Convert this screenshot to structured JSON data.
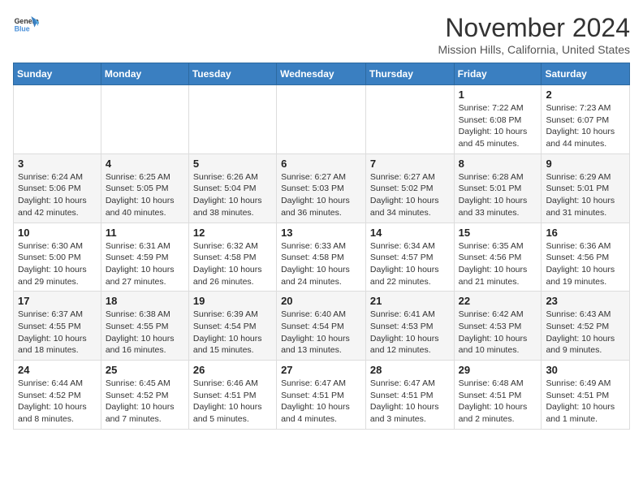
{
  "logo": {
    "line1": "General",
    "line2": "Blue"
  },
  "title": "November 2024",
  "location": "Mission Hills, California, United States",
  "days_of_week": [
    "Sunday",
    "Monday",
    "Tuesday",
    "Wednesday",
    "Thursday",
    "Friday",
    "Saturday"
  ],
  "weeks": [
    [
      {
        "day": "",
        "info": ""
      },
      {
        "day": "",
        "info": ""
      },
      {
        "day": "",
        "info": ""
      },
      {
        "day": "",
        "info": ""
      },
      {
        "day": "",
        "info": ""
      },
      {
        "day": "1",
        "info": "Sunrise: 7:22 AM\nSunset: 6:08 PM\nDaylight: 10 hours and 45 minutes."
      },
      {
        "day": "2",
        "info": "Sunrise: 7:23 AM\nSunset: 6:07 PM\nDaylight: 10 hours and 44 minutes."
      }
    ],
    [
      {
        "day": "3",
        "info": "Sunrise: 6:24 AM\nSunset: 5:06 PM\nDaylight: 10 hours and 42 minutes."
      },
      {
        "day": "4",
        "info": "Sunrise: 6:25 AM\nSunset: 5:05 PM\nDaylight: 10 hours and 40 minutes."
      },
      {
        "day": "5",
        "info": "Sunrise: 6:26 AM\nSunset: 5:04 PM\nDaylight: 10 hours and 38 minutes."
      },
      {
        "day": "6",
        "info": "Sunrise: 6:27 AM\nSunset: 5:03 PM\nDaylight: 10 hours and 36 minutes."
      },
      {
        "day": "7",
        "info": "Sunrise: 6:27 AM\nSunset: 5:02 PM\nDaylight: 10 hours and 34 minutes."
      },
      {
        "day": "8",
        "info": "Sunrise: 6:28 AM\nSunset: 5:01 PM\nDaylight: 10 hours and 33 minutes."
      },
      {
        "day": "9",
        "info": "Sunrise: 6:29 AM\nSunset: 5:01 PM\nDaylight: 10 hours and 31 minutes."
      }
    ],
    [
      {
        "day": "10",
        "info": "Sunrise: 6:30 AM\nSunset: 5:00 PM\nDaylight: 10 hours and 29 minutes."
      },
      {
        "day": "11",
        "info": "Sunrise: 6:31 AM\nSunset: 4:59 PM\nDaylight: 10 hours and 27 minutes."
      },
      {
        "day": "12",
        "info": "Sunrise: 6:32 AM\nSunset: 4:58 PM\nDaylight: 10 hours and 26 minutes."
      },
      {
        "day": "13",
        "info": "Sunrise: 6:33 AM\nSunset: 4:58 PM\nDaylight: 10 hours and 24 minutes."
      },
      {
        "day": "14",
        "info": "Sunrise: 6:34 AM\nSunset: 4:57 PM\nDaylight: 10 hours and 22 minutes."
      },
      {
        "day": "15",
        "info": "Sunrise: 6:35 AM\nSunset: 4:56 PM\nDaylight: 10 hours and 21 minutes."
      },
      {
        "day": "16",
        "info": "Sunrise: 6:36 AM\nSunset: 4:56 PM\nDaylight: 10 hours and 19 minutes."
      }
    ],
    [
      {
        "day": "17",
        "info": "Sunrise: 6:37 AM\nSunset: 4:55 PM\nDaylight: 10 hours and 18 minutes."
      },
      {
        "day": "18",
        "info": "Sunrise: 6:38 AM\nSunset: 4:55 PM\nDaylight: 10 hours and 16 minutes."
      },
      {
        "day": "19",
        "info": "Sunrise: 6:39 AM\nSunset: 4:54 PM\nDaylight: 10 hours and 15 minutes."
      },
      {
        "day": "20",
        "info": "Sunrise: 6:40 AM\nSunset: 4:54 PM\nDaylight: 10 hours and 13 minutes."
      },
      {
        "day": "21",
        "info": "Sunrise: 6:41 AM\nSunset: 4:53 PM\nDaylight: 10 hours and 12 minutes."
      },
      {
        "day": "22",
        "info": "Sunrise: 6:42 AM\nSunset: 4:53 PM\nDaylight: 10 hours and 10 minutes."
      },
      {
        "day": "23",
        "info": "Sunrise: 6:43 AM\nSunset: 4:52 PM\nDaylight: 10 hours and 9 minutes."
      }
    ],
    [
      {
        "day": "24",
        "info": "Sunrise: 6:44 AM\nSunset: 4:52 PM\nDaylight: 10 hours and 8 minutes."
      },
      {
        "day": "25",
        "info": "Sunrise: 6:45 AM\nSunset: 4:52 PM\nDaylight: 10 hours and 7 minutes."
      },
      {
        "day": "26",
        "info": "Sunrise: 6:46 AM\nSunset: 4:51 PM\nDaylight: 10 hours and 5 minutes."
      },
      {
        "day": "27",
        "info": "Sunrise: 6:47 AM\nSunset: 4:51 PM\nDaylight: 10 hours and 4 minutes."
      },
      {
        "day": "28",
        "info": "Sunrise: 6:47 AM\nSunset: 4:51 PM\nDaylight: 10 hours and 3 minutes."
      },
      {
        "day": "29",
        "info": "Sunrise: 6:48 AM\nSunset: 4:51 PM\nDaylight: 10 hours and 2 minutes."
      },
      {
        "day": "30",
        "info": "Sunrise: 6:49 AM\nSunset: 4:51 PM\nDaylight: 10 hours and 1 minute."
      }
    ]
  ]
}
